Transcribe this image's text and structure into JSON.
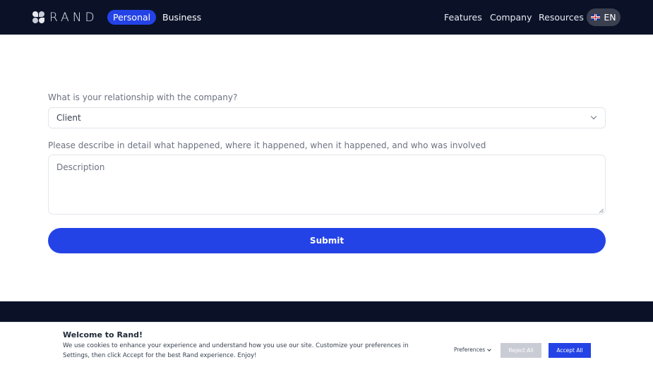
{
  "nav": {
    "logo_text": "RAND",
    "personal_label": "Personal",
    "business_label": "Business",
    "features_label": "Features",
    "company_label": "Company",
    "resources_label": "Resources",
    "language_label": "EN",
    "language_flag_icon": "uk-flag-icon",
    "active_tab": "Personal",
    "colors": {
      "bar": "#0b1228",
      "active_pill": "#2443e6"
    }
  },
  "form": {
    "relationship_question": "What is your relationship with the company?",
    "relationship_value": "Client",
    "description_question": "Please describe in detail what happened, where it happened, when it happened, and who was involved",
    "description_placeholder": "Description",
    "submit_label": "Submit",
    "colors": {
      "accent": "#2443e6"
    }
  },
  "cookie": {
    "title": "Welcome to Rand!",
    "text": "We use cookies to enhance your experience and understand how you use our site. Customize your preferences in Settings, then click Accept for the best Rand experience. Enjoy!",
    "preferences_label": "Preferences",
    "reject_label": "Reject All",
    "accept_label": "Accept All"
  }
}
